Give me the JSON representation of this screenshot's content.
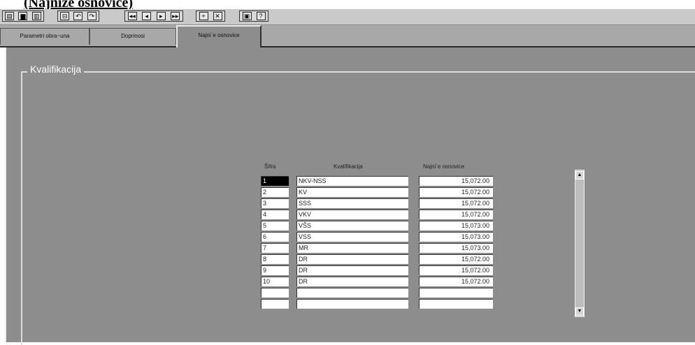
{
  "caption": "(Najniže osnovice)",
  "toolbar": {
    "group1": [
      "▤",
      "▆",
      "▥"
    ],
    "group2": [
      "⊟",
      "↶",
      "↷"
    ],
    "group3": [
      "◂◂",
      "◂",
      "▸",
      "▸▸"
    ],
    "group4": [
      "+",
      "✕"
    ],
    "group5": [
      "▣",
      "?"
    ]
  },
  "tabs": [
    "Parametri obra~una",
    "Doprinosi",
    "Najni`e osnovice"
  ],
  "group_title": "Kvalifikacija",
  "table": {
    "headers": [
      "Šifra",
      "Kvalifikacija",
      "Najni`e osnovice"
    ],
    "rows": [
      [
        "1",
        "NKV-NSS",
        "15,072.00"
      ],
      [
        "2",
        "KV",
        "15,072.00"
      ],
      [
        "3",
        "SSS",
        "15,072.00"
      ],
      [
        "4",
        "VKV",
        "15,072.00"
      ],
      [
        "5",
        "VŠS",
        "15,073.00"
      ],
      [
        "6",
        "VSS",
        "15,073.00"
      ],
      [
        "7",
        "MR",
        "15,073.00"
      ],
      [
        "8",
        "DR",
        "15,072.00"
      ],
      [
        "9",
        "DR",
        "15,072.00"
      ],
      [
        "10",
        "DR",
        "15,072.00"
      ],
      [
        "",
        "",
        ""
      ],
      [
        "",
        "",
        ""
      ]
    ]
  },
  "scrollbar": {
    "up": "▲",
    "down": "▼"
  }
}
